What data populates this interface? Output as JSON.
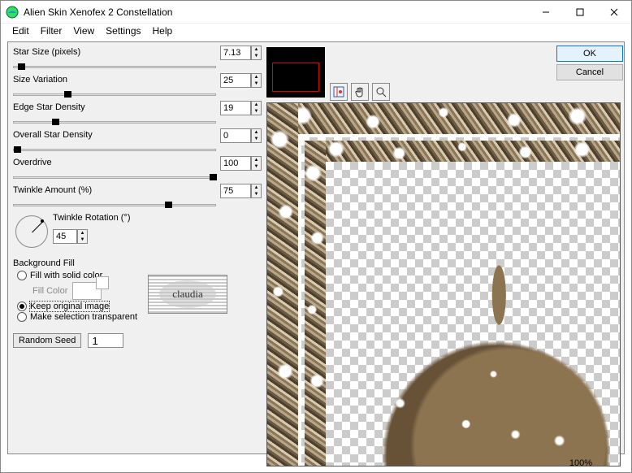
{
  "window": {
    "title": "Alien Skin Xenofex 2 Constellation"
  },
  "menu": [
    "Edit",
    "Filter",
    "View",
    "Settings",
    "Help"
  ],
  "params": [
    {
      "label": "Star Size (pixels)",
      "value": "7.13",
      "pos": 2
    },
    {
      "label": "Size Variation",
      "value": "25",
      "pos": 25
    },
    {
      "label": "Edge Star Density",
      "value": "19",
      "pos": 19
    },
    {
      "label": "Overall Star Density",
      "value": "0",
      "pos": 0
    },
    {
      "label": "Overdrive",
      "value": "100",
      "pos": 97
    },
    {
      "label": "Twinkle Amount (%)",
      "value": "75",
      "pos": 75
    }
  ],
  "rotation": {
    "label": "Twinkle Rotation (°)",
    "value": "45"
  },
  "bgfill": {
    "label": "Background Fill",
    "opt_solid": "Fill with solid color",
    "fill_color_label": "Fill Color",
    "opt_keep": "Keep original image",
    "opt_transparent": "Make selection transparent",
    "selected": "keep"
  },
  "random": {
    "button": "Random Seed",
    "value": "1"
  },
  "buttons": {
    "ok": "OK",
    "cancel": "Cancel"
  },
  "status": {
    "zoom": "100%"
  },
  "watermark": "claudia"
}
